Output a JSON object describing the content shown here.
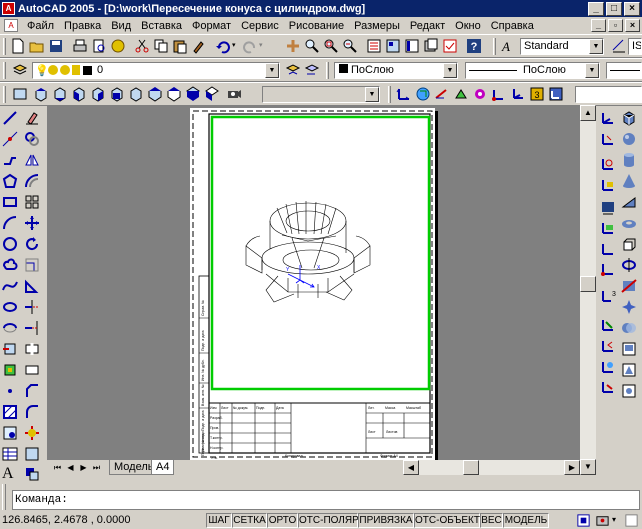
{
  "window": {
    "title": "AutoCAD 2005 - [D:\\work\\Пересечение конуса с цилиндром.dwg]",
    "app_icon": "autocad-logo-icon",
    "min": "_",
    "max": "□",
    "close": "×"
  },
  "menu": [
    "Файл",
    "Правка",
    "Вид",
    "Вставка",
    "Формат",
    "Сервис",
    "Рисование",
    "Размеры",
    "Редакт",
    "Окно",
    "Справка"
  ],
  "toolbar1": {
    "text_style": "Standard",
    "style2": "IS"
  },
  "toolbar2": {
    "layer": "0",
    "color": "ПоСлою",
    "linetype": "ПоСлою"
  },
  "drawing": {
    "title_cells": [
      "Изм",
      "Лист",
      "№ докум.",
      "Подп.",
      "Дата",
      "Разраб.",
      "Пров.",
      "Т.контр.",
      "Н.контр.",
      "Утв.",
      "Лит.",
      "Масса",
      "Масштаб",
      "Лист",
      "Листов",
      "Копировал",
      "Формат А4"
    ],
    "stamp_side": [
      "Перв. примен.",
      "Справ. №",
      "Подп. и дата",
      "Инв. № дубл.",
      "Взам. инв. №",
      "Подп. и дата",
      "Инв. № подл."
    ]
  },
  "tabs": {
    "model": "Модель",
    "layout": "A4"
  },
  "command": {
    "prompt": "Команда:"
  },
  "status": {
    "coords": "126.8465, 2.4678 , 0.0000",
    "buttons": [
      "ШАГ",
      "СЕТКА",
      "ОРТО",
      "ОТС-ПОЛЯР",
      "ПРИВЯЗКА",
      "ОТС-ОБЪЕКТ",
      "ВЕС",
      "МОДЕЛЬ"
    ]
  },
  "colors": {
    "title_bg": "#0a246a",
    "viewport_border": "#00cc00",
    "ucs": "#0000ff"
  }
}
